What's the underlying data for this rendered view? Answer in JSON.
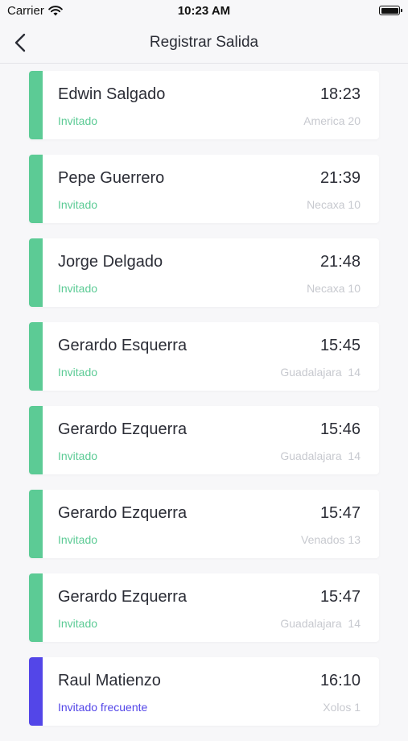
{
  "status_bar": {
    "carrier": "Carrier",
    "time": "10:23 AM"
  },
  "nav": {
    "title": "Registrar Salida"
  },
  "colors": {
    "guest": "#5ccb95",
    "frequent_guest": "#5346e8"
  },
  "visits": [
    {
      "name": "Edwin Salgado",
      "time": "18:23",
      "type": "Invitado",
      "address": "America 20",
      "color": "#5ccb95"
    },
    {
      "name": "Pepe Guerrero",
      "time": "21:39",
      "type": "Invitado",
      "address": "Necaxa 10",
      "color": "#5ccb95"
    },
    {
      "name": "Jorge Delgado",
      "time": "21:48",
      "type": "Invitado",
      "address": "Necaxa 10",
      "color": "#5ccb95"
    },
    {
      "name": "Gerardo Esquerra",
      "time": "15:45",
      "type": "Invitado",
      "address": "Guadalajara  14",
      "color": "#5ccb95"
    },
    {
      "name": "Gerardo Ezquerra",
      "time": "15:46",
      "type": "Invitado",
      "address": "Guadalajara  14",
      "color": "#5ccb95"
    },
    {
      "name": "Gerardo Ezquerra",
      "time": "15:47",
      "type": "Invitado",
      "address": "Venados 13",
      "color": "#5ccb95"
    },
    {
      "name": "Gerardo Ezquerra",
      "time": "15:47",
      "type": "Invitado",
      "address": "Guadalajara  14",
      "color": "#5ccb95"
    },
    {
      "name": "Raul Matienzo",
      "time": "16:10",
      "type": "Invitado frecuente",
      "address": "Xolos 1",
      "color": "#5346e8"
    }
  ]
}
